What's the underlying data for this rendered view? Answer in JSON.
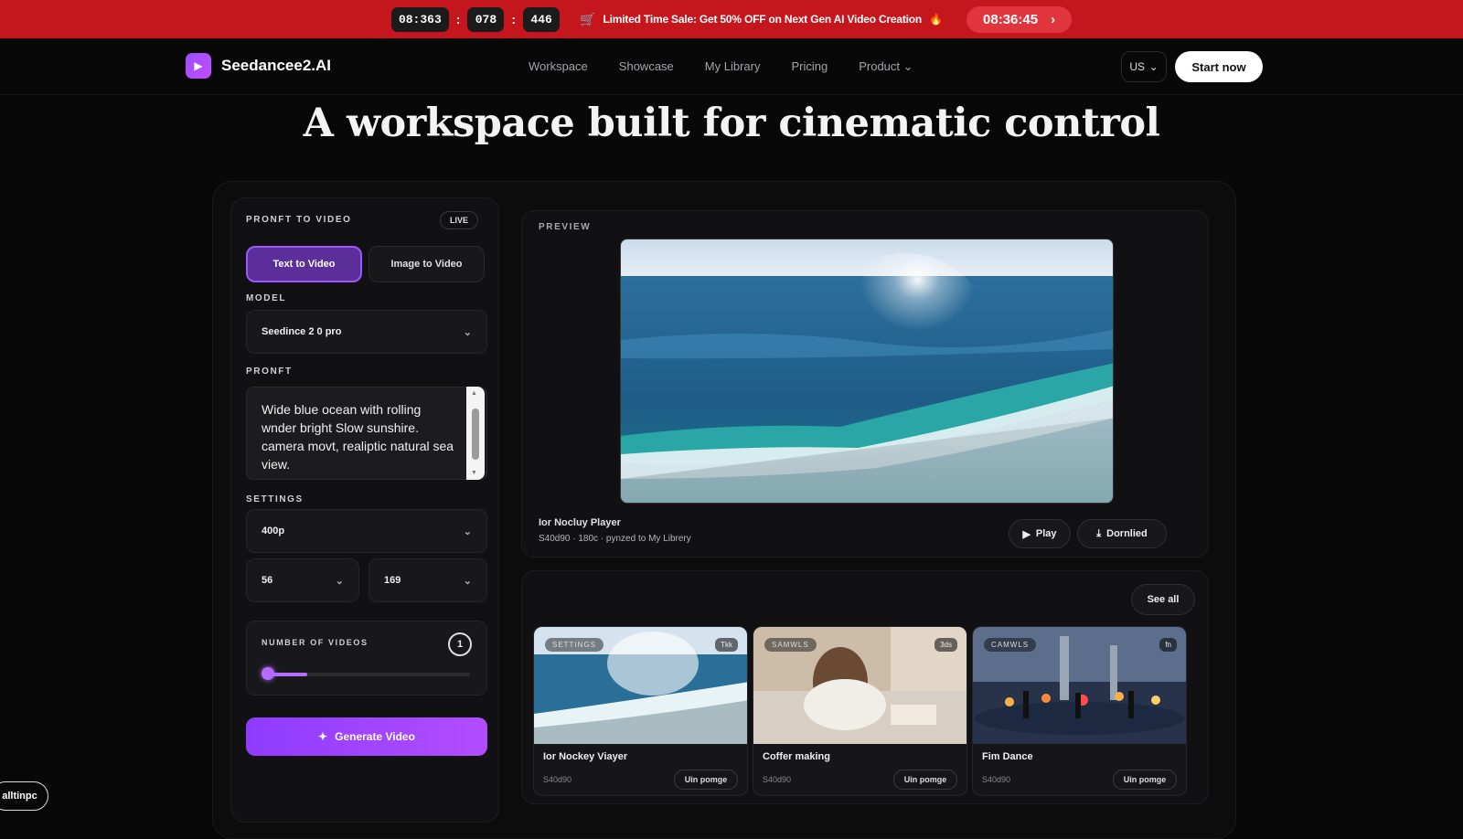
{
  "promo": {
    "timer": [
      "08:363",
      "078",
      "446"
    ],
    "message": "Limited Time Sale: Get 50% OFF on Next Gen AI Video Creation",
    "countdown": "08:36:45"
  },
  "nav": {
    "brand": "Seedancee2.AI",
    "items": [
      "Workspace",
      "Showcase",
      "My Library",
      "Pricing",
      "Product"
    ],
    "lang": "US",
    "cta": "Start now"
  },
  "hero": {
    "title": "A workspace built for cinematic control"
  },
  "panel": {
    "section_label": "PRONFT TO VIDEO",
    "live": "LIVE",
    "tabs": [
      "Text to Video",
      "Image to Video"
    ],
    "model_label": "MODEL",
    "model_value": "Seedince 2 0 pro",
    "prompt_label": "PRONFT",
    "prompt_text": "Wide blue ocean with rolling wnder bright Slow sunshire. camera movt, realiptic natural sea view.",
    "settings_label": "SETTINGS",
    "resolution": "400p",
    "duration": "56",
    "ratio": "169",
    "num_label": "NUMBER OF VIDEOS",
    "num_value": "1",
    "num_fraction": 0.2,
    "generate": "Generate Video"
  },
  "preview": {
    "label": "PREVIEW",
    "title": "Ior Nocluy Player",
    "subtitle": "S40d90 · 180c · pynzed to My Librery",
    "play": "Play",
    "download": "Dornlied"
  },
  "gallery": {
    "see_all": "See all",
    "cards": [
      {
        "tag": "SETTINGS",
        "dur": "Tkk",
        "title": "Ior Nockey Viayer",
        "sub": "S40d90",
        "btn": "Uin pomge"
      },
      {
        "tag": "SAMWLS",
        "dur": "3ds",
        "title": "Coffer making",
        "sub": "S40d90",
        "btn": "Uin pomge"
      },
      {
        "tag": "CAMWLS",
        "dur": "fn",
        "title": "Fim Dance",
        "sub": "S40d90",
        "btn": "Uin pomge"
      }
    ]
  },
  "corner_pill": "alltinpc",
  "colors": {
    "promo_red": "#c5161d",
    "accent_purple": "#9b4dff",
    "background": "#080808"
  }
}
